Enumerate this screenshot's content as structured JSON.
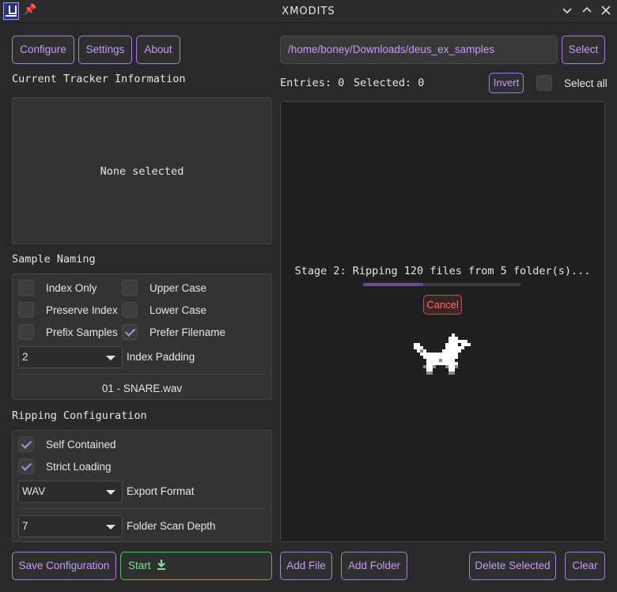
{
  "window": {
    "title": "XMODITS"
  },
  "left": {
    "buttons": {
      "configure": "Configure",
      "settings": "Settings",
      "about": "About"
    },
    "tracker_heading": "Current Tracker Information",
    "tracker_empty": "None selected",
    "naming_heading": "Sample Naming",
    "naming": {
      "index_only": "Index Only",
      "upper_case": "Upper Case",
      "preserve_index": "Preserve Index",
      "lower_case": "Lower Case",
      "prefix_samples": "Prefix Samples",
      "prefer_filename": "Prefer Filename",
      "index_padding_value": "2",
      "index_padding_label": "Index Padding",
      "preview": "01 - SNARE.wav",
      "checked": {
        "index_only": false,
        "upper_case": false,
        "preserve_index": false,
        "lower_case": false,
        "prefix_samples": false,
        "prefer_filename": true
      }
    },
    "ripping_heading": "Ripping Configuration",
    "ripping": {
      "self_contained": "Self Contained",
      "strict_loading": "Strict Loading",
      "export_format_value": "WAV",
      "export_format_label": "Export Format",
      "scan_depth_value": "7",
      "scan_depth_label": "Folder Scan Depth",
      "checked": {
        "self_contained": true,
        "strict_loading": true
      }
    },
    "save_configuration": "Save Configuration",
    "start": "Start"
  },
  "right": {
    "path": "/home/boney/Downloads/deus_ex_samples",
    "select": "Select",
    "entries": "Entries: 0",
    "selected": "Selected: 0",
    "invert": "Invert",
    "select_all": "Select all",
    "status": "Stage 2: Ripping 120 files from 5 folder(s)...",
    "progress": 0.38,
    "cancel": "Cancel",
    "add_file": "Add File",
    "add_folder": "Add Folder",
    "delete_selected": "Delete Selected",
    "clear": "Clear"
  },
  "colors": {
    "accent": "#c49cf5",
    "start": "#7fe08e",
    "cancel": "#ff6b6b"
  },
  "icons": [
    "app-icon",
    "pin-icon",
    "chevron-down-icon",
    "chevron-up-icon",
    "close-icon",
    "download-icon",
    "fox-sprite"
  ]
}
